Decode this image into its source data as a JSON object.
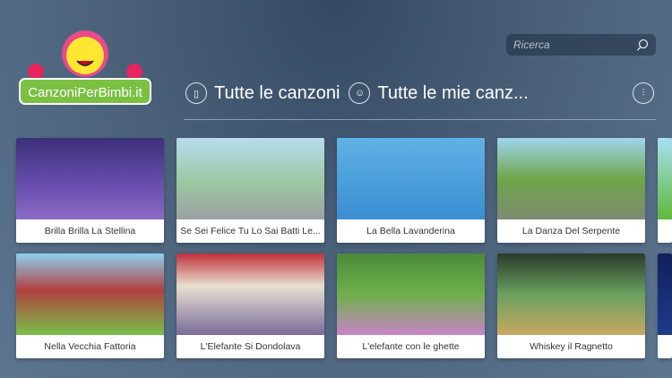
{
  "logo": {
    "text": "CanzoniPerBimbi.it"
  },
  "search": {
    "placeholder": "Ricerca"
  },
  "nav": {
    "all_songs": "Tutte le canzoni",
    "my_songs": "Tutte le mie canz..."
  },
  "songs": [
    {
      "title": "Brilla Brilla La Stellina",
      "bg": "linear-gradient(#3c2f7a,#6a4fb0 60%,#8a6cc4)"
    },
    {
      "title": "Se Sei Felice Tu Lo Sai Batti Le...",
      "bg": "linear-gradient(#b7dcef,#9cc8a0 55%,#9aa0a4)"
    },
    {
      "title": "La Bella Lavanderina",
      "bg": "linear-gradient(#5fb2e6,#3a8ed0)"
    },
    {
      "title": "La Danza Del Serpente",
      "bg": "linear-gradient(#9fd5ee,#6fa64a 50%,#7d8a70)"
    },
    {
      "title": "",
      "bg": "linear-gradient(#a8e0f0,#5fb83a)"
    },
    {
      "title": "Nella Vecchia Fattoria",
      "bg": "linear-gradient(#8fcff0,#b04040 45%,#7bbf4a)"
    },
    {
      "title": "L'Elefante Si Dondolava",
      "bg": "linear-gradient(#c0303a,#e8e0d0 40%,#7a6a9a)"
    },
    {
      "title": "L'elefante con le ghette",
      "bg": "linear-gradient(#4a8a3a,#6fb04a 50%,#c784c8)"
    },
    {
      "title": "Whiskey il Ragnetto",
      "bg": "linear-gradient(#2a3a2a,#6aa060 50%,#c8a860)"
    },
    {
      "title": "",
      "bg": "linear-gradient(#10205a,#203a8a)"
    }
  ]
}
